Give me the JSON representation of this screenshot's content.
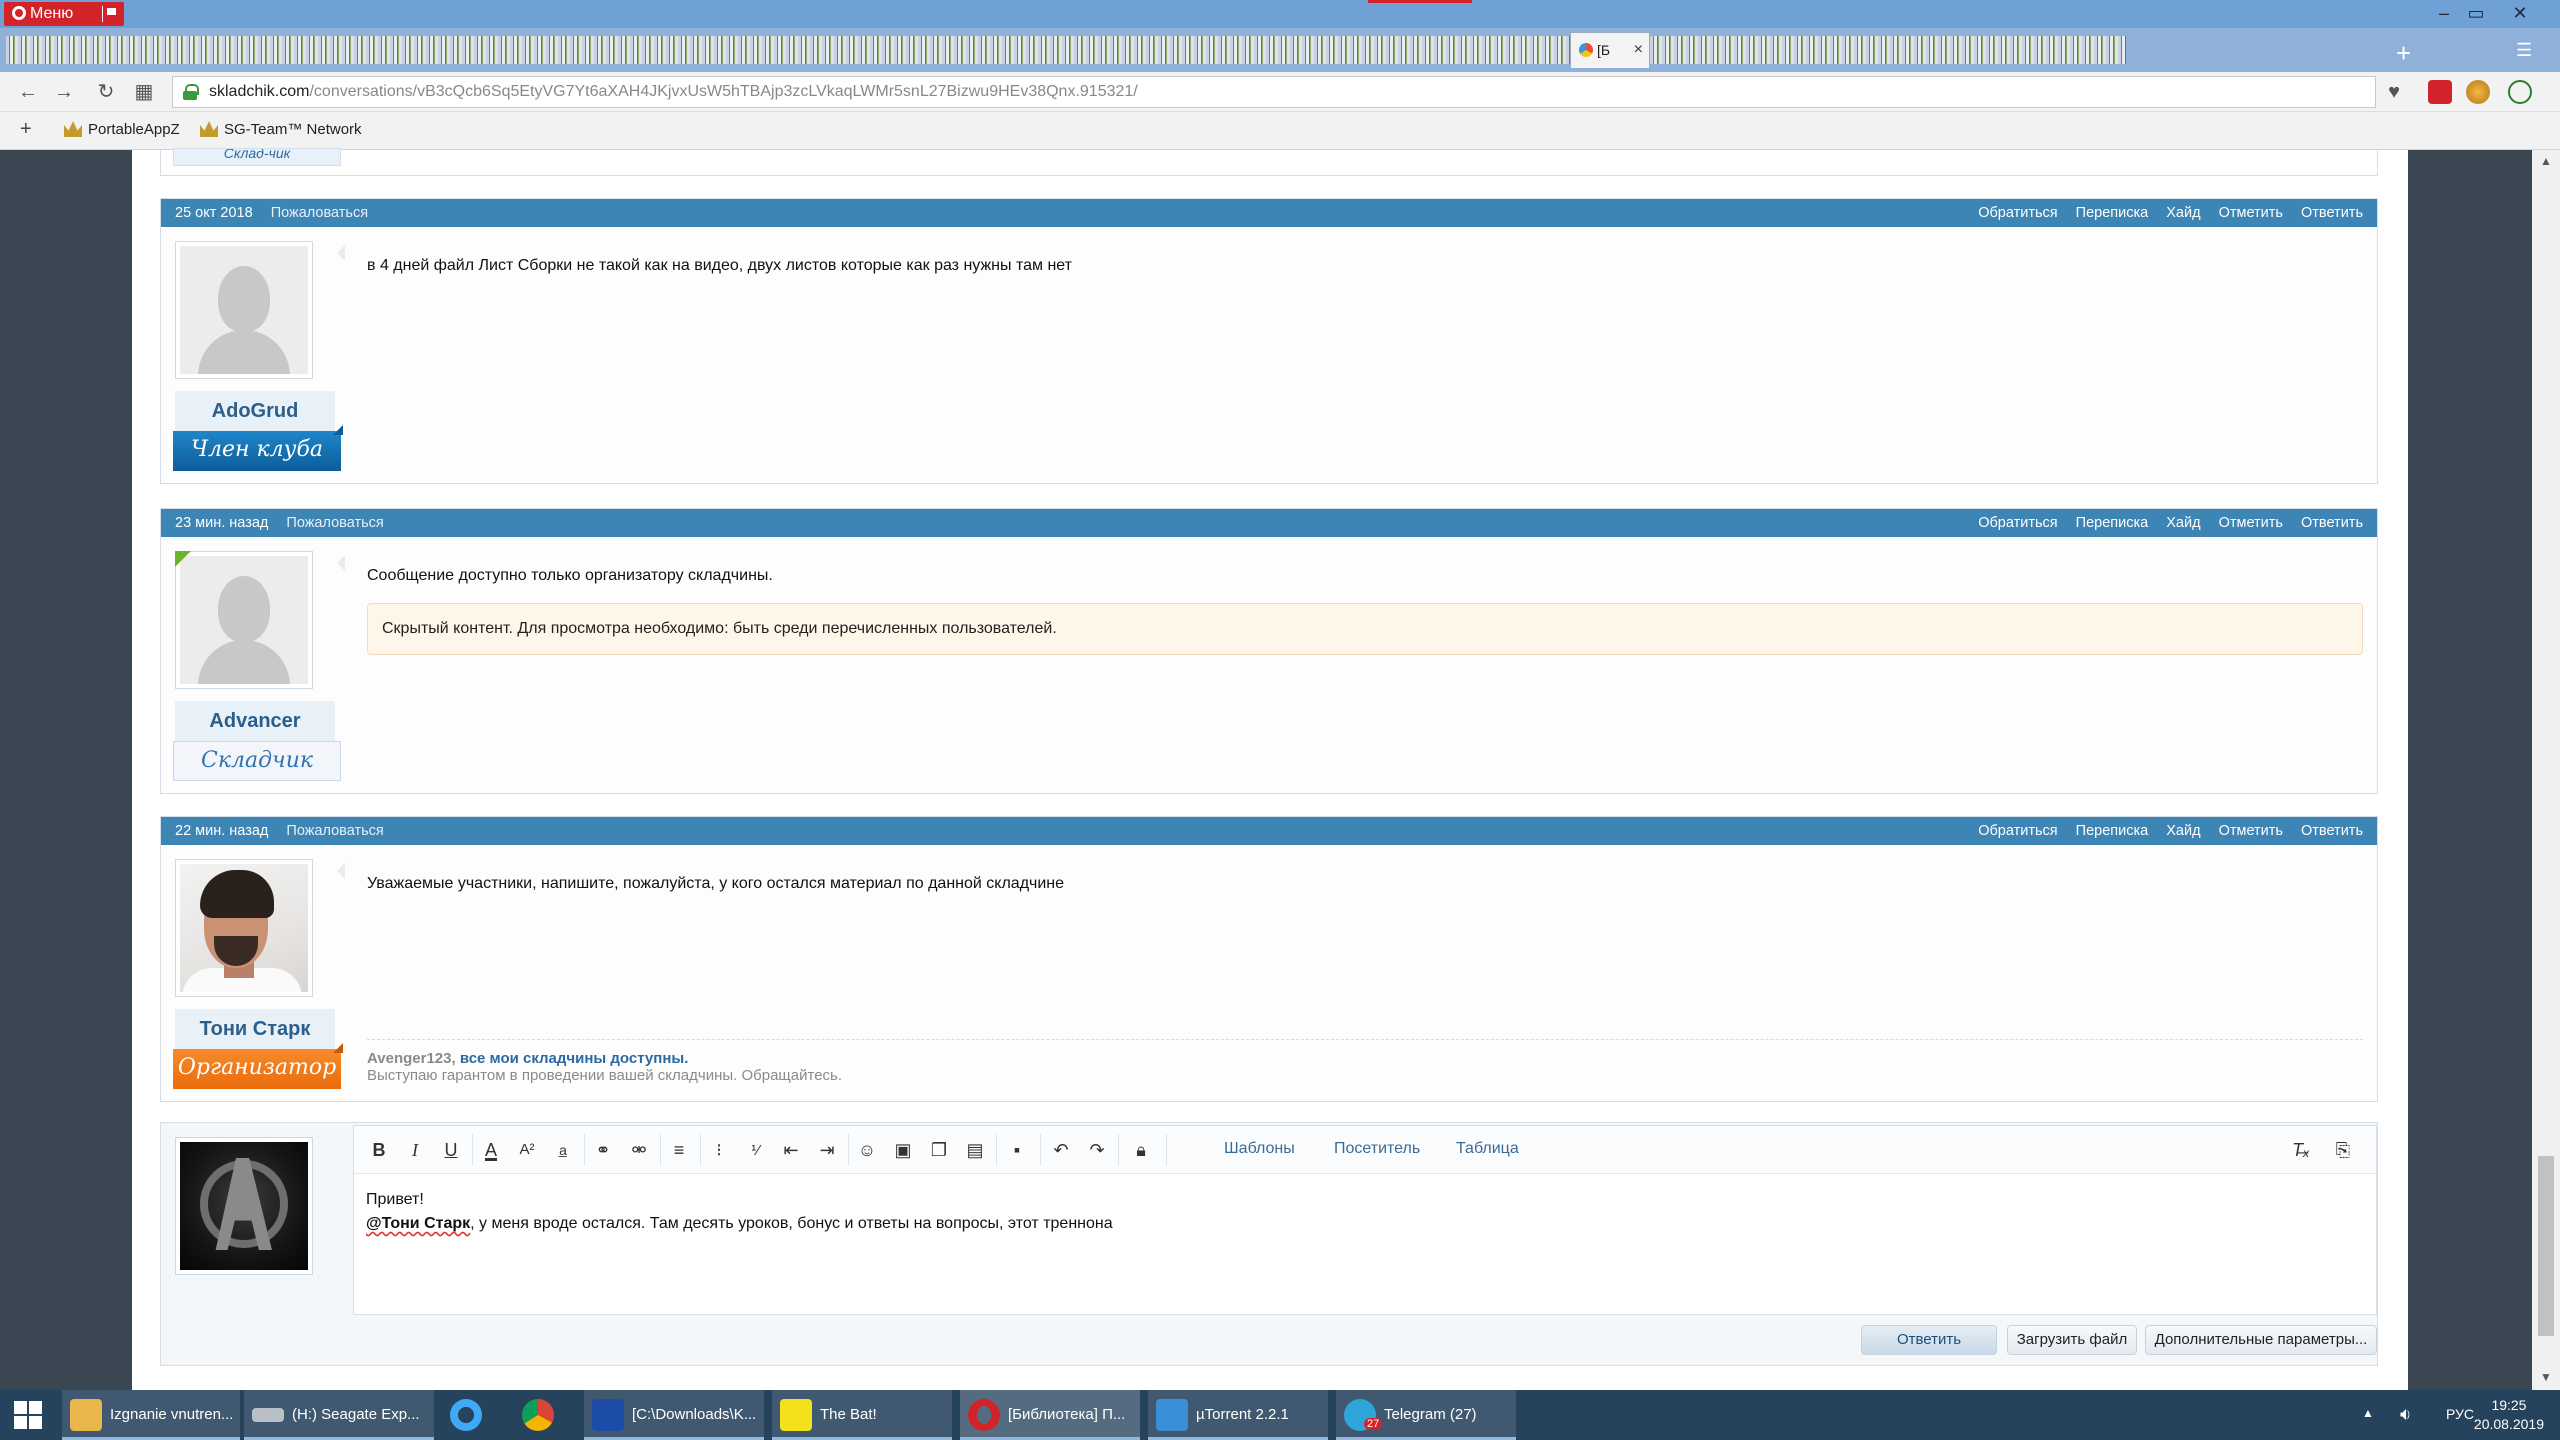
{
  "browser": {
    "menu_label": "Меню",
    "active_tab_label": "[Б",
    "tab_close": "×",
    "new_tab": "+",
    "url_host": "skladchik.com",
    "url_path": "/conversations/vB3cQcb6Sq5EtyVG7Yt6aXAH4JKjvxUsW5hTBAjp3zcLVkaqLWMr5snL27Bizwu9HEv38Qnx.915321/",
    "bookmarks": [
      "PortableAppZ",
      "SG-Team™ Network"
    ]
  },
  "previous_post": {
    "badge": "Склад-чик"
  },
  "posts": [
    {
      "date": "25 окт 2018",
      "report": "Пожаловаться",
      "actions": [
        "Обратиться",
        "Переписка",
        "Хайд",
        "Отметить",
        "Ответить"
      ],
      "username": "AdoGrud",
      "user_title": "Член клуба",
      "message": "в 4 дней файл Лист Сборки не такой как на видео, двух листов которые как раз нужны там нет"
    },
    {
      "date": "23 мин. назад",
      "report": "Пожаловаться",
      "actions": [
        "Обратиться",
        "Переписка",
        "Хайд",
        "Отметить",
        "Ответить"
      ],
      "username": "Advancer",
      "user_title": "Складчик",
      "message": "Сообщение доступно только организатору складчины.",
      "hidden_notice": "Скрытый контент. Для просмотра необходимо: быть среди перечисленных пользователей."
    },
    {
      "date": "22 мин. назад",
      "report": "Пожаловаться",
      "actions": [
        "Обратиться",
        "Переписка",
        "Хайд",
        "Отметить",
        "Ответить"
      ],
      "username": "Тони Старк",
      "user_title": "Организатор",
      "message": "Уважаемые участники, напишите, пожалуйста, у кого остался материал по данной складчине",
      "signature": {
        "name": "Avenger123,",
        "link": "все мои складчины доступны.",
        "text": "Выступаю гарантом в проведении вашей складчины. Обращайтесь."
      }
    }
  ],
  "editor": {
    "toolbar_text_buttons": [
      "Шаблоны",
      "Посетитель",
      "Таблица"
    ],
    "line1": "Привет!",
    "mention": "@Тони Старк",
    "line2_rest": ", у меня вроде остался. Там десять уроков, бонус и ответы на вопросы, этот треннона",
    "buttons": {
      "submit": "Ответить",
      "upload": "Загрузить файл",
      "more": "Дополнительные параметры..."
    }
  },
  "taskbar": {
    "items": [
      "Izgnanie vnutren...",
      "(H:) Seagate Exp...",
      "",
      "",
      "[C:\\Downloads\\K...",
      "The Bat!",
      "[Библиотека] П...",
      "µTorrent 2.2.1",
      "Telegram (27)"
    ],
    "telegram_badge": "27",
    "lang": "РУС",
    "time": "19:25",
    "date": "20.08.2019"
  },
  "colors": {
    "post_header": "#3d85b5",
    "page_background": "#3b4653",
    "opera_red": "#d2232a",
    "title_member": "#1f86c9",
    "title_organizer": "#f78b2a"
  },
  "icons": {
    "toolbar": [
      "bold-icon",
      "italic-icon",
      "underline-icon",
      "font-color-icon",
      "font-size-icon",
      "font-family-icon",
      "link-icon",
      "unlink-icon",
      "align-icon",
      "bullet-list-icon",
      "numbered-list-icon",
      "outdent-icon",
      "indent-icon",
      "smiley-icon",
      "image-icon",
      "media-icon",
      "code-icon",
      "save-draft-icon",
      "undo-icon",
      "redo-icon",
      "hide-lock-icon"
    ]
  }
}
